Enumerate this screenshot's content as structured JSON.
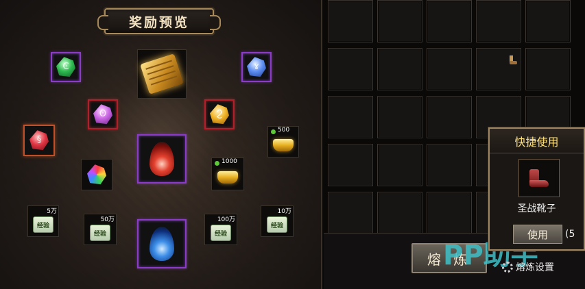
{
  "reward_panel": {
    "title": "奖励预览",
    "ingots": [
      {
        "amount": "500"
      },
      {
        "amount": "1000"
      }
    ],
    "exp_scrolls": [
      {
        "label": "5万",
        "text": "经验"
      },
      {
        "label": "50万",
        "text": "经验"
      },
      {
        "label": "100万",
        "text": "经验"
      },
      {
        "label": "10万",
        "text": "经验"
      }
    ]
  },
  "smelt": {
    "button_label": "熔 炼",
    "settings_label": "熔炼设置"
  },
  "watermark": "PP助手",
  "quick_use": {
    "title": "快捷使用",
    "item_name": "圣战靴子",
    "use_label": "使用",
    "count": "(5"
  },
  "colors": {
    "accent_gold": "#ffe07a",
    "border_gold": "#a08660",
    "purple_border": "#8a3cc8",
    "red_border": "#b0202a"
  }
}
